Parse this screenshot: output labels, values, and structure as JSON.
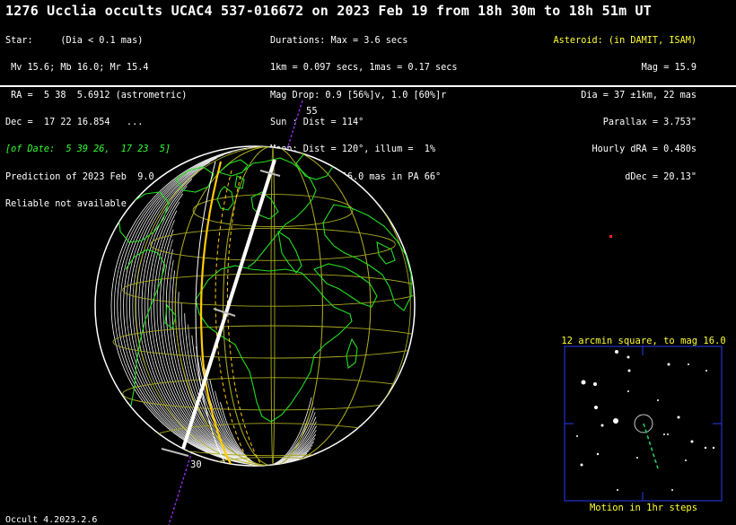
{
  "title": "1276 Ucclia occults UCAC4 537-016672 on 2023 Feb 19 from 18h 30m to 18h 51m UT",
  "star_info": {
    "line1": "Star:     (Dia < 0.1 mas)",
    "line2": " Mv 15.6; Mb 16.0; Mr 15.4",
    "line3": " RA =  5 38  5.6912 (astrometric)",
    "line4": "Dec =  17 22 16.854   ...",
    "line5": "[of Date:  5 39 26,  17 23  5]",
    "line6": "Prediction of 2023 Feb  9.0",
    "line7": "Reliable not available"
  },
  "event_info": {
    "line1": "Durations: Max = 3.6 secs",
    "line2": "1km = 0.097 secs, 1mas = 0.17 secs",
    "line3": "Mag Drop: 0.9 [56%]v, 1.0 [60%]r",
    "line4": "Sun : Dist = 114°",
    "line5": "Moon: Dist = 120°, illum =  1%",
    "line6": "Error 25.0 x 16.0 mas in PA 66°"
  },
  "asteroid_info": {
    "header": "Asteroid: (in DAMIT, ISAM)",
    "mag": "Mag = 15.9",
    "dia": "Dia = 37 ±1km, 22 mas",
    "parallax": "Parallax = 3.753\"",
    "hourly_dra": "Hourly dRA = 0.480s",
    "ddec": "dDec = 20.13\""
  },
  "map": {
    "tick_top": "55",
    "tick_bottom": "30",
    "colors": {
      "coast": "#22dd22",
      "grid": "#a8a820",
      "path_center": "#ffffff",
      "path_limits": "#ffcc00",
      "track": "#8a2be2"
    }
  },
  "star_chart": {
    "title": "12 arcmin square, to mag 16.0",
    "footer": "Motion in 1hr steps",
    "border_color": "#2233cc"
  },
  "version": "Occult 4.2023.2.6"
}
